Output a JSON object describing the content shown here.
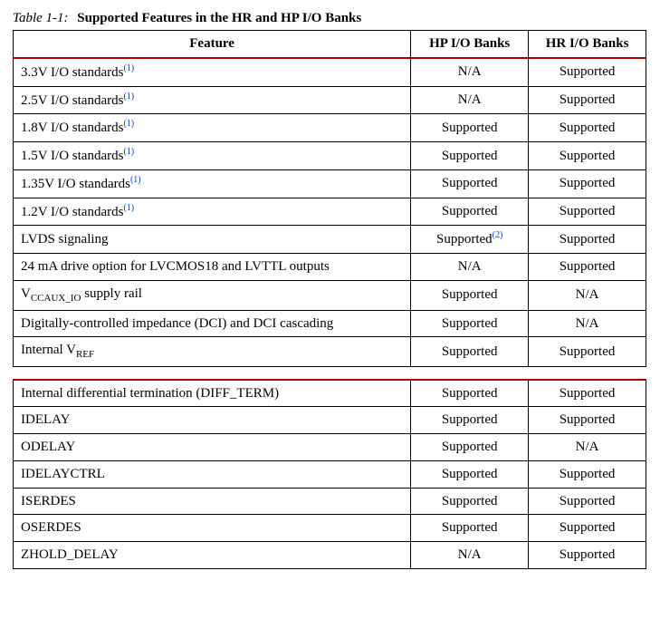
{
  "table": {
    "label": "Table 1-1:",
    "title": "Supported Features in the HR and HP I/O Banks",
    "columns": [
      "Feature",
      "HP I/O Banks",
      "HR I/O Banks"
    ],
    "rows1": [
      {
        "feature": "3.3V I/O standards",
        "fn": "(1)",
        "hp": "N/A",
        "hr": "Supported"
      },
      {
        "feature": "2.5V I/O standards",
        "fn": "(1)",
        "hp": "N/A",
        "hr": "Supported"
      },
      {
        "feature": "1.8V I/O standards",
        "fn": "(1)",
        "hp": "Supported",
        "hr": "Supported"
      },
      {
        "feature": "1.5V I/O standards",
        "fn": "(1)",
        "hp": "Supported",
        "hr": "Supported"
      },
      {
        "feature": "1.35V I/O standards",
        "fn": "(1)",
        "hp": "Supported",
        "hr": "Supported"
      },
      {
        "feature": "1.2V I/O standards",
        "fn": "(1)",
        "hp": "Supported",
        "hr": "Supported"
      },
      {
        "feature": "LVDS signaling",
        "fn": "",
        "hp": "Supported",
        "hp_fn": "(2)",
        "hr": "Supported"
      },
      {
        "feature": "24 mA drive option for LVCMOS18 and LVTTL outputs",
        "fn": "",
        "hp": "N/A",
        "hr": "Supported"
      },
      {
        "feature_html": "V<span class=\"sub\">CCAUX_IO</span> supply rail",
        "fn": "",
        "hp": "Supported",
        "hr": "N/A"
      },
      {
        "feature": "Digitally-controlled impedance (DCI) and DCI cascading",
        "fn": "",
        "hp": "Supported",
        "hr": "N/A"
      },
      {
        "feature_html": "Internal V<span class=\"sub\">REF</span>",
        "fn": "",
        "hp": "Supported",
        "hr": "Supported"
      }
    ],
    "rows2": [
      {
        "feature": "Internal differential termination (DIFF_TERM)",
        "hp": "Supported",
        "hr": "Supported"
      },
      {
        "feature": "IDELAY",
        "hp": "Supported",
        "hr": "Supported"
      },
      {
        "feature": "ODELAY",
        "hp": "Supported",
        "hr": "N/A"
      },
      {
        "feature": "IDELAYCTRL",
        "hp": "Supported",
        "hr": "Supported"
      },
      {
        "feature": "ISERDES",
        "hp": "Supported",
        "hr": "Supported"
      },
      {
        "feature": "OSERDES",
        "hp": "Supported",
        "hr": "Supported"
      },
      {
        "feature": "ZHOLD_DELAY",
        "hp": "N/A",
        "hr": "Supported"
      }
    ]
  }
}
